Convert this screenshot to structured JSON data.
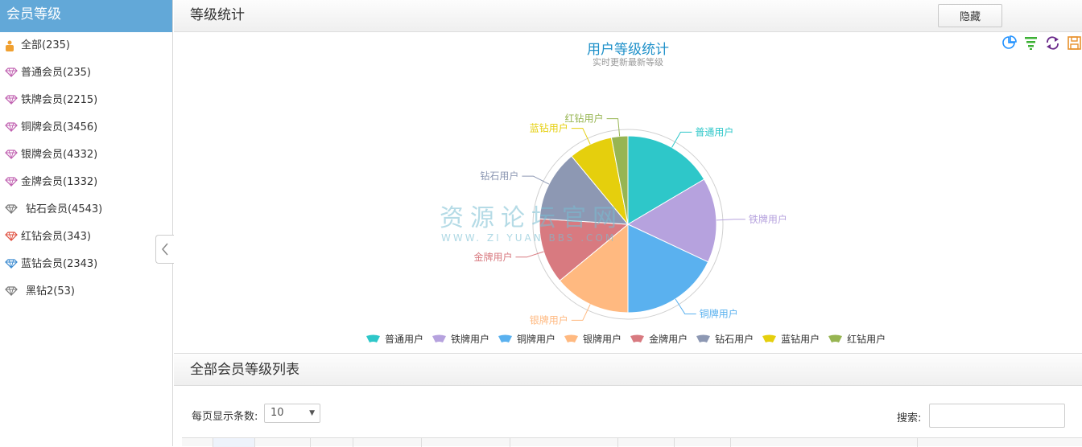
{
  "sidebar": {
    "title": "会员等级",
    "items": [
      {
        "label": "全部(235)",
        "icon": "user-bag-icon",
        "color": "#f0a030"
      },
      {
        "label": "普通会员(235)",
        "icon": "diamond-icon",
        "color": "#c060b0"
      },
      {
        "label": "铁牌会员(2215)",
        "icon": "diamond-icon",
        "color": "#c060b0"
      },
      {
        "label": "铜牌会员(3456)",
        "icon": "diamond-icon",
        "color": "#c060b0"
      },
      {
        "label": "银牌会员(4332)",
        "icon": "diamond-icon",
        "color": "#c060b0"
      },
      {
        "label": "金牌会员(1332)",
        "icon": "diamond-icon",
        "color": "#c060b0"
      },
      {
        "label": "钻石会员(4543)",
        "icon": "diamond-icon",
        "color": "#777777"
      },
      {
        "label": "红钻会员(343)",
        "icon": "diamond-icon",
        "color": "#e05040"
      },
      {
        "label": "蓝钻会员(2343)",
        "icon": "diamond-icon",
        "color": "#3a8ad0"
      },
      {
        "label": "黑钻2(53)",
        "icon": "diamond-icon",
        "color": "#777777"
      }
    ]
  },
  "header": {
    "title": "等级统计",
    "hide_label": "隐藏"
  },
  "watermark": {
    "main": "资源论坛官网",
    "sub": "WWW. ZI YUAN BBS .COM"
  },
  "list": {
    "title": "全部会员等级列表",
    "per_page_label": "每页显示条数:",
    "per_page_value": "10",
    "search_label": "搜索:",
    "search_value": ""
  },
  "chart_data": {
    "type": "pie",
    "title": "用户等级统计",
    "subtitle": "实时更新最新等级",
    "categories": [
      "普通用户",
      "铁牌用户",
      "铜牌用户",
      "银牌用户",
      "金牌用户",
      "钻石用户",
      "蓝钻用户",
      "红钻用户"
    ],
    "values": [
      16.5,
      15.5,
      18,
      14,
      12,
      13,
      8,
      3
    ],
    "colors": [
      "#2ec7c9",
      "#b6a2de",
      "#5ab1ef",
      "#ffb980",
      "#d87a80",
      "#8d98b3",
      "#e5cf0d",
      "#97b552"
    ],
    "legend_position": "bottom"
  }
}
